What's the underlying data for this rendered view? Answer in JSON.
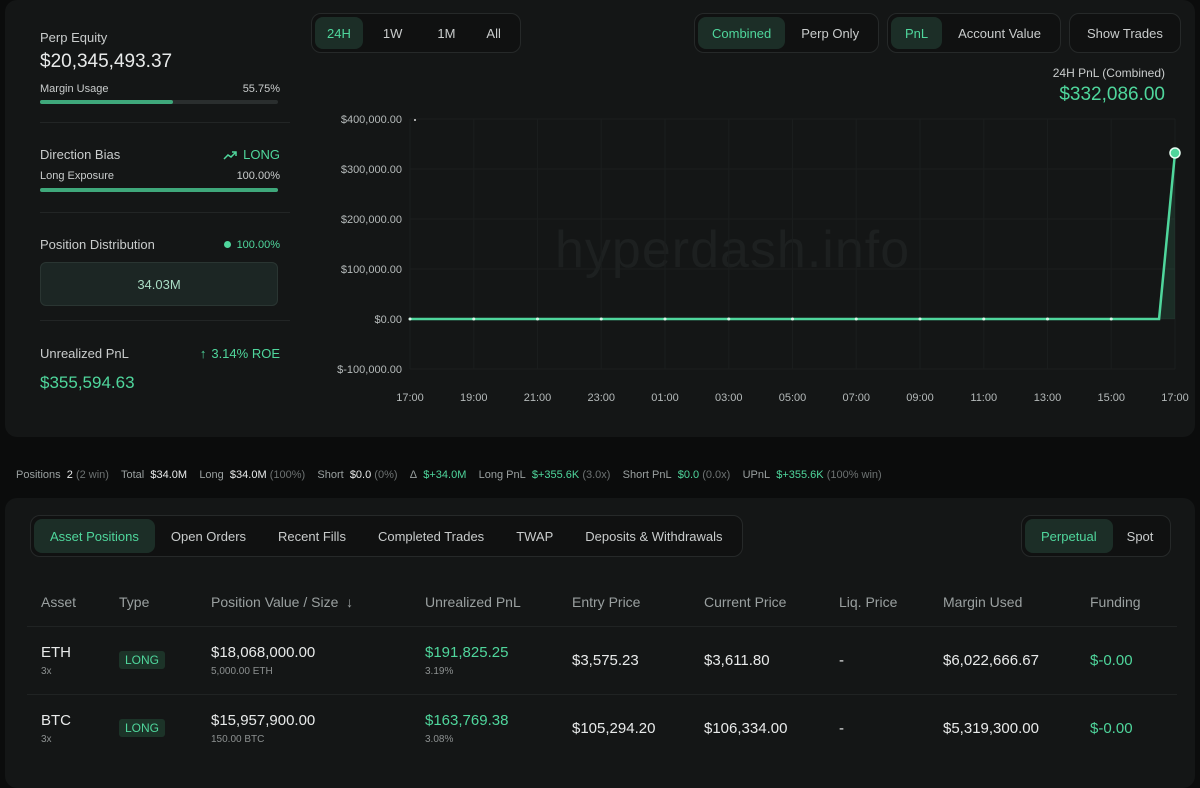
{
  "left": {
    "perp_equity_label": "Perp Equity",
    "perp_equity_value": "$20,345,493.37",
    "margin_usage_label": "Margin Usage",
    "margin_usage_value": "55.75%",
    "margin_usage_fraction": 0.5575,
    "direction_bias_label": "Direction Bias",
    "direction_bias_value": "LONG",
    "long_exposure_label": "Long Exposure",
    "long_exposure_value": "100.00%",
    "long_exposure_fraction": 1.0,
    "position_distribution_label": "Position Distribution",
    "position_distribution_value": "100.00%",
    "position_distribution_amount": "34.03M",
    "unrealized_pnl_label": "Unrealized PnL",
    "roe_value": "3.14% ROE",
    "unrealized_pnl_value": "$355,594.63"
  },
  "controls": {
    "ranges": [
      "24H",
      "1W",
      "1M",
      "All"
    ],
    "range_active": "24H",
    "scope": [
      "Combined",
      "Perp Only"
    ],
    "scope_active": "Combined",
    "metric": [
      "PnL",
      "Account Value"
    ],
    "metric_active": "PnL",
    "show_trades": "Show Trades"
  },
  "summary": {
    "label": "24H PnL (Combined)",
    "value": "$332,086.00"
  },
  "watermark": "hyperdash.info",
  "chart_data": {
    "type": "line",
    "x": [
      "17:00",
      "19:00",
      "21:00",
      "23:00",
      "01:00",
      "03:00",
      "05:00",
      "07:00",
      "09:00",
      "11:00",
      "13:00",
      "15:00",
      "16:30",
      "17:00"
    ],
    "series": [
      {
        "values": [
          0,
          0,
          0,
          0,
          0,
          0,
          0,
          0,
          0,
          0,
          0,
          0,
          0,
          332086
        ]
      }
    ],
    "yticks": [
      "$400,000.00",
      "$300,000.00",
      "$200,000.00",
      "$100,000.00",
      "$0.00",
      "$-100,000.00"
    ],
    "xticks": [
      "17:00",
      "19:00",
      "21:00",
      "23:00",
      "01:00",
      "03:00",
      "05:00",
      "07:00",
      "09:00",
      "11:00",
      "13:00",
      "15:00",
      "17:00"
    ],
    "ylim": [
      -100000,
      400000
    ],
    "color": "#4fd69c"
  },
  "stats": {
    "positions_label": "Positions",
    "positions_value": "2",
    "positions_note": "(2 win)",
    "total_label": "Total",
    "total_value": "$34.0M",
    "long_label": "Long",
    "long_value": "$34.0M",
    "long_note": "(100%)",
    "short_label": "Short",
    "short_value": "$0.0",
    "short_note": "(0%)",
    "delta_label": "Δ",
    "delta_value": "$+34.0M",
    "long_pnl_label": "Long PnL",
    "long_pnl_value": "$+355.6K",
    "long_pnl_note": "(3.0x)",
    "short_pnl_label": "Short PnL",
    "short_pnl_value": "$0.0",
    "short_pnl_note": "(0.0x)",
    "upnl_label": "UPnL",
    "upnl_value": "$+355.6K",
    "upnl_note": "(100% win)"
  },
  "tabs": [
    "Asset Positions",
    "Open Orders",
    "Recent Fills",
    "Completed Trades",
    "TWAP",
    "Deposits & Withdrawals"
  ],
  "tab_active": "Asset Positions",
  "modes": [
    "Perpetual",
    "Spot"
  ],
  "mode_active": "Perpetual",
  "table": {
    "headers": [
      "Asset",
      "Type",
      "Position Value / Size",
      "Unrealized PnL",
      "Entry Price",
      "Current Price",
      "Liq. Price",
      "Margin Used",
      "Funding"
    ],
    "sort_indicator": "↓",
    "rows": [
      {
        "asset": "ETH",
        "leverage": "3x",
        "type": "LONG",
        "value": "$18,068,000.00",
        "size": "5,000.00 ETH",
        "pnl": "$191,825.25",
        "pnl_pct": "3.19%",
        "entry": "$3,575.23",
        "current": "$3,611.80",
        "liq": "-",
        "margin": "$6,022,666.67",
        "funding": "$-0.00"
      },
      {
        "asset": "BTC",
        "leverage": "3x",
        "type": "LONG",
        "value": "$15,957,900.00",
        "size": "150.00 BTC",
        "pnl": "$163,769.38",
        "pnl_pct": "3.08%",
        "entry": "$105,294.20",
        "current": "$106,334.00",
        "liq": "-",
        "margin": "$5,319,300.00",
        "funding": "$-0.00"
      }
    ]
  }
}
